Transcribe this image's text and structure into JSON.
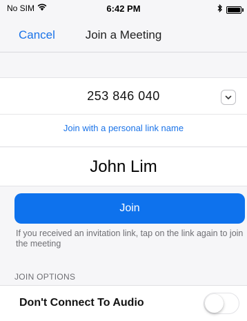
{
  "status_bar": {
    "carrier": "No SIM",
    "time": "6:42 PM",
    "icons": [
      "wifi-icon",
      "bluetooth-icon",
      "battery-icon"
    ]
  },
  "nav": {
    "cancel_label": "Cancel",
    "title": "Join a Meeting"
  },
  "meeting": {
    "meeting_id": "253 846 040",
    "personal_link_label": "Join with a personal link name"
  },
  "name_field": {
    "value": "John Lim"
  },
  "join": {
    "button_label": "Join",
    "hint": "If you received an invitation link, tap on the link again to join the meeting"
  },
  "join_options": {
    "section_label": "JOIN OPTIONS",
    "options": [
      {
        "label": "Don't Connect To Audio",
        "enabled": false
      }
    ]
  },
  "colors": {
    "accent": "#0e72ed",
    "link": "#1a73e8",
    "background": "#f6f6f8"
  }
}
